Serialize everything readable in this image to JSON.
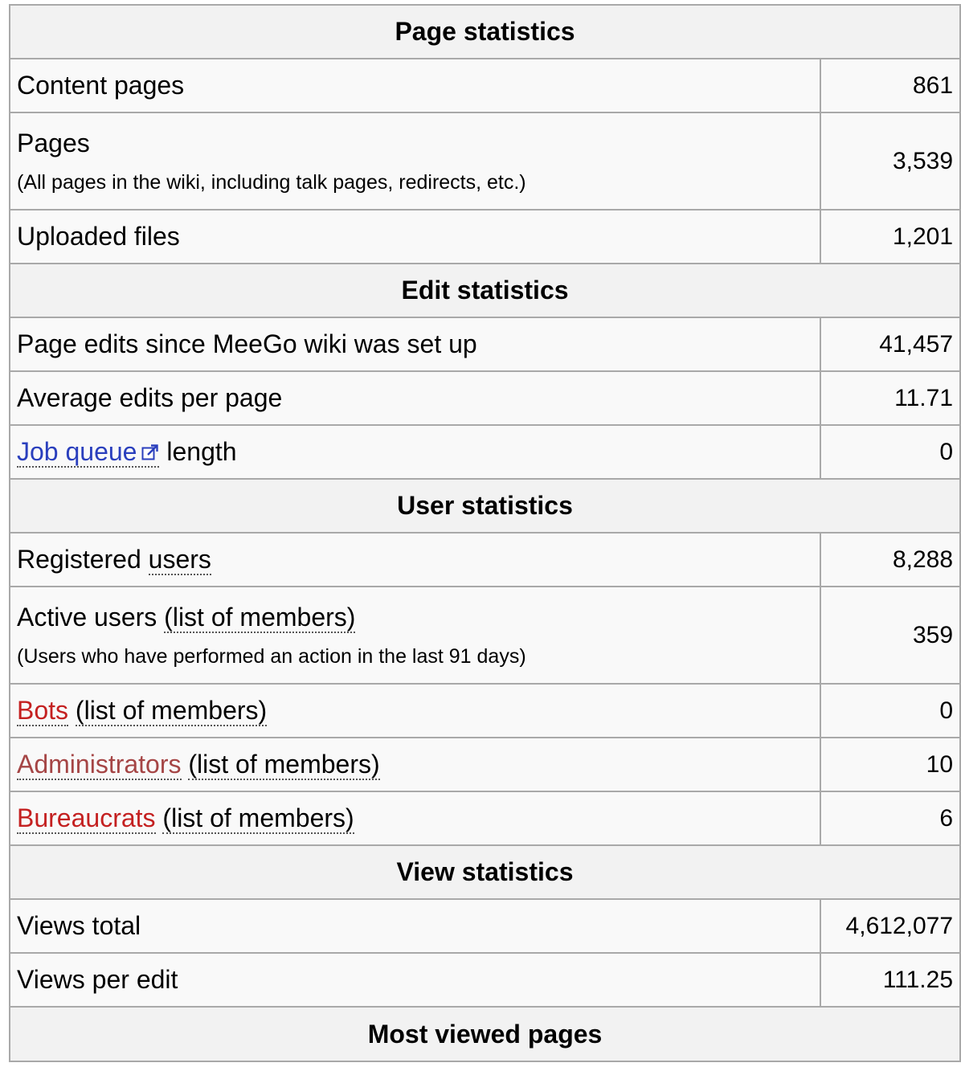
{
  "sections": {
    "page": "Page statistics",
    "edit": "Edit statistics",
    "user": "User statistics",
    "view": "View statistics",
    "most_viewed": "Most viewed pages"
  },
  "page_stats": {
    "content_pages": {
      "label": "Content pages",
      "value": "861"
    },
    "pages": {
      "label": "Pages",
      "note": "(All pages in the wiki, including talk pages, redirects, etc.)",
      "value": "3,539"
    },
    "uploaded_files": {
      "label": "Uploaded files",
      "value": "1,201"
    }
  },
  "edit_stats": {
    "page_edits": {
      "label": "Page edits since MeeGo wiki was set up",
      "value": "41,457"
    },
    "avg_edits": {
      "label": "Average edits per page",
      "value": "11.71"
    },
    "job_queue": {
      "link": "Job queue",
      "suffix": " length",
      "value": "0"
    }
  },
  "user_stats": {
    "registered": {
      "prefix": "Registered ",
      "link": "users",
      "value": "8,288"
    },
    "active": {
      "prefix": "Active users ",
      "link": "(list of members)",
      "note": "(Users who have performed an action in the last 91 days)",
      "value": "359"
    },
    "bots": {
      "link": "Bots",
      "list_link": "(list of members)",
      "value": "0"
    },
    "administrators": {
      "link": "Administrators",
      "list_link": "(list of members)",
      "value": "10"
    },
    "bureaucrats": {
      "link": "Bureaucrats",
      "list_link": "(list of members)",
      "value": "6"
    }
  },
  "view_stats": {
    "views_total": {
      "label": "Views total",
      "value": "4,612,077"
    },
    "views_per_edit": {
      "label": "Views per edit",
      "value": "111.25"
    }
  },
  "icons": {
    "external_link": "external-link-icon"
  },
  "colors": {
    "link_blue": "#2a3fbd",
    "link_red": "#c42020",
    "link_red_visited": "#a54545",
    "header_bg": "#f2f2f2",
    "cell_bg": "#f9f9f9",
    "border": "#a9a9a9"
  }
}
